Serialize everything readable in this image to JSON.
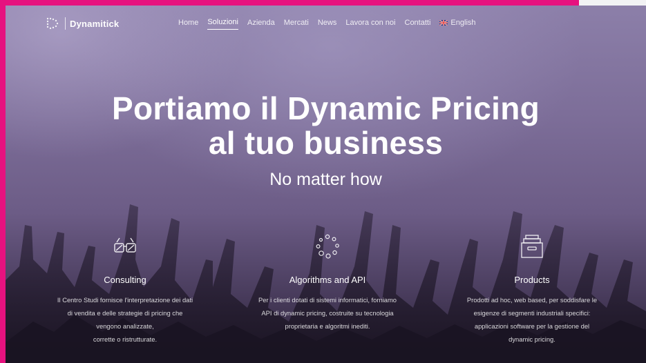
{
  "brand": {
    "name": "Dynamitick"
  },
  "nav": {
    "items": [
      {
        "label": "Home",
        "active": false
      },
      {
        "label": "Soluzioni",
        "active": true
      },
      {
        "label": "Azienda",
        "active": false
      },
      {
        "label": "Mercati",
        "active": false
      },
      {
        "label": "News",
        "active": false
      },
      {
        "label": "Lavora con noi",
        "active": false
      },
      {
        "label": "Contatti",
        "active": false
      }
    ],
    "language": {
      "label": "English",
      "icon": "uk-flag-icon"
    }
  },
  "hero": {
    "title_line1": "Portiamo il Dynamic Pricing",
    "title_line2": "al tuo business",
    "subtitle": "No matter how"
  },
  "features": [
    {
      "icon": "3d-glasses-icon",
      "title": "Consulting",
      "lines": [
        "Il Centro Studi fornisce l'interpretazione dei dati",
        "di vendita e delle strategie di pricing che",
        "vengono analizzate,",
        "corrette o ristrutturate."
      ]
    },
    {
      "icon": "dotted-circle-icon",
      "title": "Algorithms and API",
      "lines": [
        "Per i clienti dotati di sistemi informatici, forniamo",
        "API di dynamic pricing, costruite su tecnologia",
        "proprietaria e algoritmi inediti."
      ]
    },
    {
      "icon": "archive-box-icon",
      "title": "Products",
      "lines": [
        "Prodotti ad hoc, web based, per soddisfare le",
        "esigenze di segmenti industriali specifici:",
        "applicazioni software per la gestione del",
        "dynamic pricing."
      ]
    }
  ],
  "colors": {
    "frame": "#e6127f",
    "text": "#ffffff",
    "background": "#7c6d98"
  }
}
